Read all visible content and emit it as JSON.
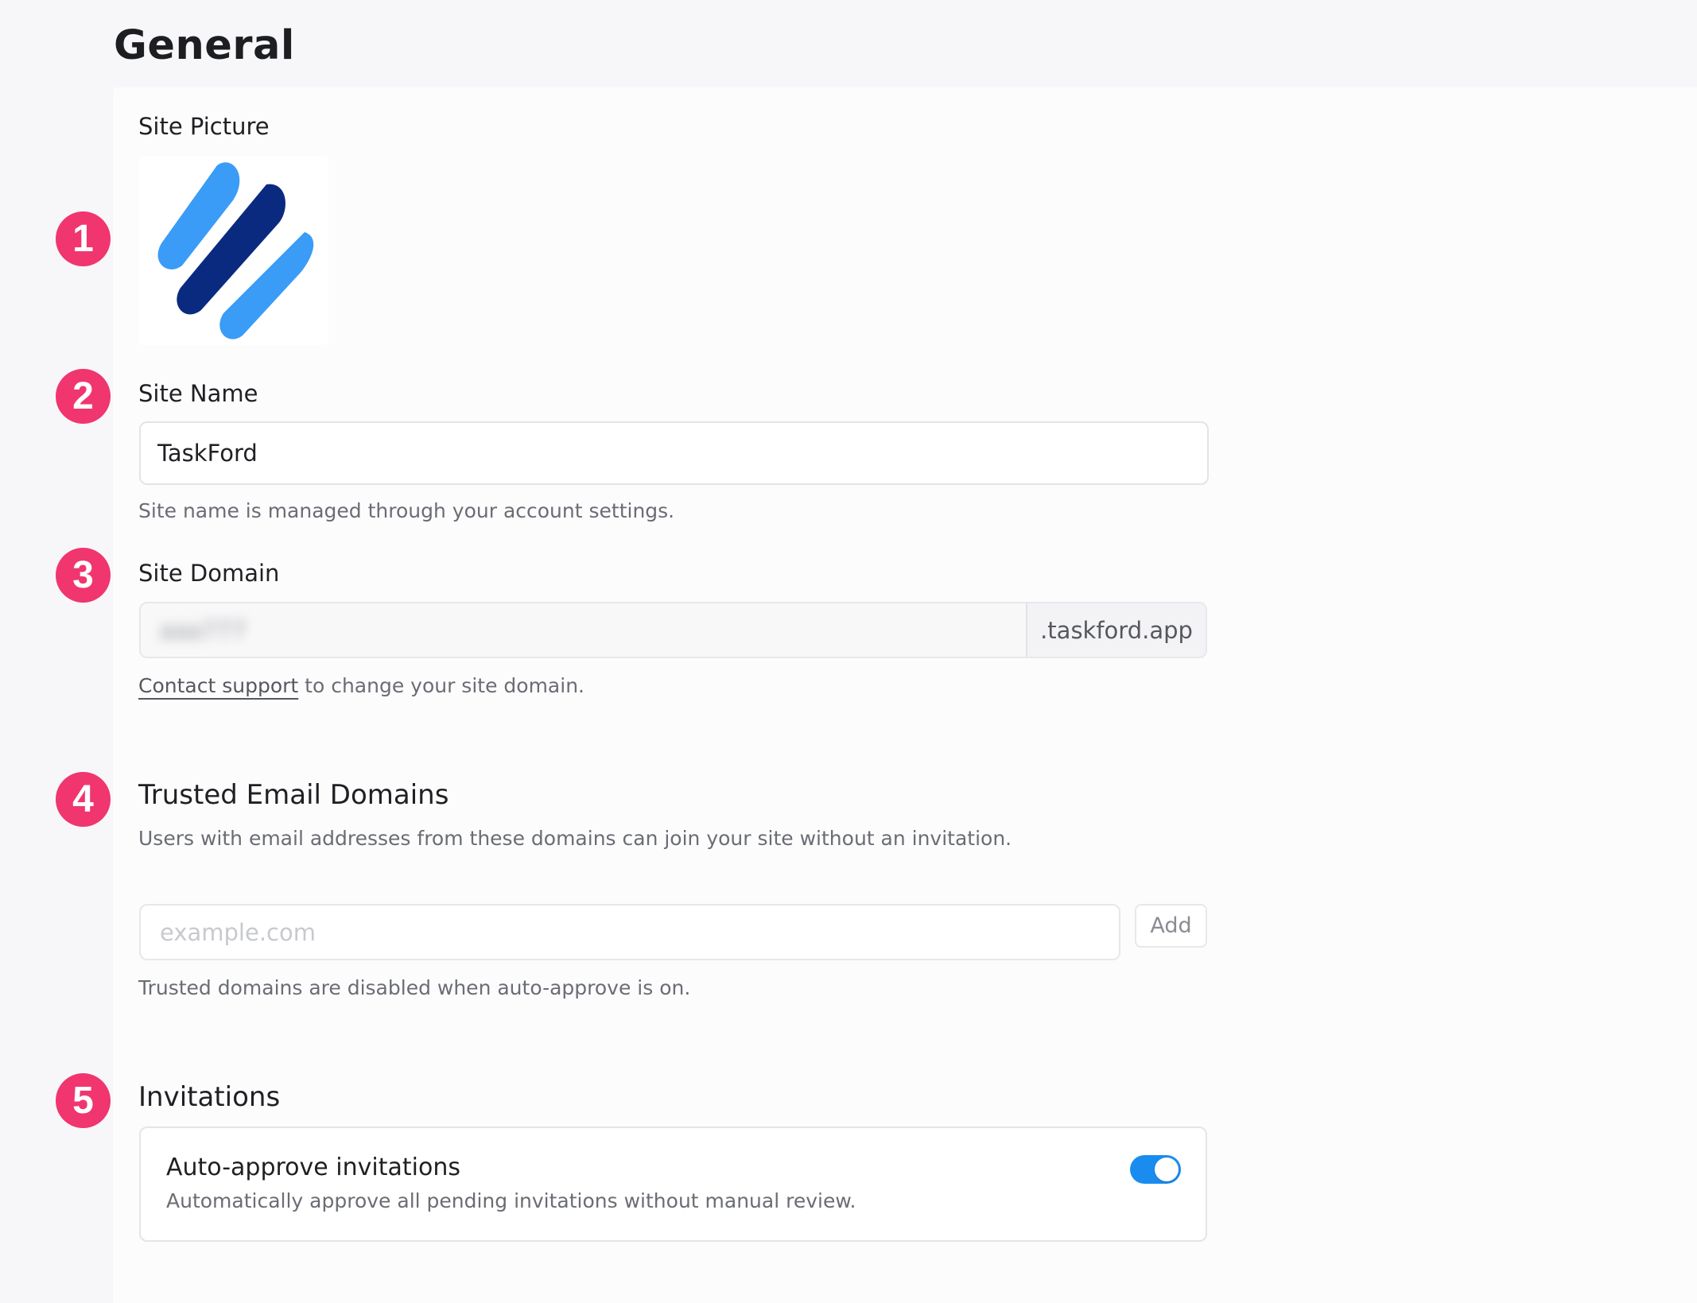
{
  "page": {
    "title": "General"
  },
  "colors": {
    "badge": "#f0356f",
    "toggle_on": "#1a8cf0",
    "logo_light": "#3a9cf6",
    "logo_dark": "#0a2a80"
  },
  "badges": [
    "1",
    "2",
    "3",
    "4",
    "5"
  ],
  "site_picture": {
    "label": "Site Picture",
    "icon": "taskford-logo-icon"
  },
  "site_name": {
    "label": "Site Name",
    "value": "TaskFord",
    "help": "Site name is managed through your account settings."
  },
  "site_domain": {
    "label": "Site Domain",
    "value": "aaa777",
    "suffix": ".taskford.app",
    "help_link": "Contact support",
    "help_rest": " to change your site domain."
  },
  "trusted_domains": {
    "heading": "Trusted Email Domains",
    "description": "Users with email addresses from these domains can join your site without an invitation.",
    "placeholder": "example.com",
    "add_label": "Add",
    "help": "Trusted domains are disabled when auto-approve is on."
  },
  "invitations": {
    "heading": "Invitations",
    "auto_approve_title": "Auto-approve invitations",
    "auto_approve_description": "Automatically approve all pending invitations without manual review.",
    "auto_approve_enabled": true
  }
}
